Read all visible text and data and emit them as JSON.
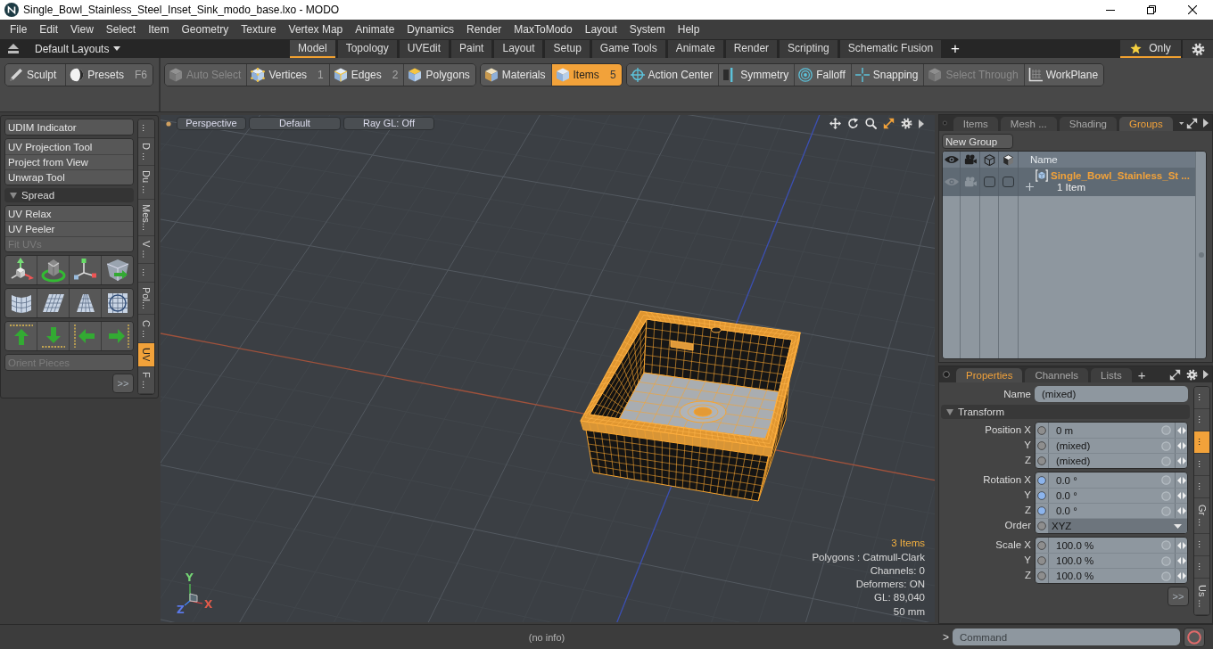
{
  "window": {
    "title": "Single_Bowl_Stainless_Steel_Inset_Sink_modo_base.lxo - MODO"
  },
  "menu": [
    "File",
    "Edit",
    "View",
    "Select",
    "Item",
    "Geometry",
    "Texture",
    "Vertex Map",
    "Animate",
    "Dynamics",
    "Render",
    "MaxToModo",
    "Layout",
    "System",
    "Help"
  ],
  "layout_bar": {
    "layouts": "Default Layouts",
    "tabs": [
      {
        "label": "Model",
        "selected": true
      },
      {
        "label": "Topology",
        "selected": false
      },
      {
        "label": "UVEdit",
        "selected": false
      },
      {
        "label": "Paint",
        "selected": false
      },
      {
        "label": "Layout",
        "selected": false
      },
      {
        "label": "Setup",
        "selected": false
      },
      {
        "label": "Game Tools",
        "selected": false
      },
      {
        "label": "Animate",
        "selected": false
      },
      {
        "label": "Render",
        "selected": false
      },
      {
        "label": "Scripting",
        "selected": false
      },
      {
        "label": "Schematic Fusion",
        "selected": false
      }
    ],
    "add": "+",
    "filter": {
      "label": "Only",
      "on": true
    }
  },
  "toolbar": {
    "groups": [
      {
        "items": [
          {
            "label": "Sculpt",
            "selected": false,
            "disabled": false
          },
          {
            "label": "Presets",
            "shortcut": "F6",
            "selected": false,
            "disabled": false
          }
        ]
      },
      {
        "items": [
          {
            "label": "Auto Select",
            "selected": false,
            "disabled": true
          },
          {
            "label": "Vertices",
            "shortcut": "1",
            "selected": false,
            "disabled": false
          },
          {
            "label": "Edges",
            "shortcut": "2",
            "selected": false,
            "disabled": false
          },
          {
            "label": "Polygons",
            "selected": false,
            "disabled": false
          }
        ]
      },
      {
        "items": [
          {
            "label": "Materials",
            "selected": false,
            "disabled": false
          },
          {
            "label": "Items",
            "shortcut": "5",
            "selected": true,
            "disabled": false
          }
        ]
      },
      {
        "items": [
          {
            "label": "Action Center",
            "selected": false,
            "disabled": false
          },
          {
            "label": "Symmetry",
            "selected": false,
            "disabled": false
          },
          {
            "label": "Falloff",
            "selected": false,
            "disabled": false
          },
          {
            "label": "Snapping",
            "selected": false,
            "disabled": false
          },
          {
            "label": "Select Through",
            "selected": false,
            "disabled": true
          },
          {
            "label": "WorkPlane",
            "selected": false,
            "disabled": false
          }
        ]
      }
    ]
  },
  "left_panel": {
    "sections": [
      {
        "kind": "buttons",
        "items": [
          {
            "label": "UDIM Indicator",
            "disabled": false
          }
        ]
      },
      {
        "kind": "buttons",
        "items": [
          {
            "label": "UV Projection Tool",
            "disabled": false
          },
          {
            "label": "Project from View",
            "disabled": false
          },
          {
            "label": "Unwrap Tool",
            "disabled": false
          }
        ]
      },
      {
        "kind": "header",
        "label": "Spread",
        "expanded": true
      },
      {
        "kind": "buttons",
        "items": [
          {
            "label": "UV Relax",
            "disabled": false
          },
          {
            "label": "UV Peeler",
            "disabled": false
          },
          {
            "label": "Fit UVs",
            "disabled": true
          }
        ]
      },
      {
        "kind": "icon_row"
      },
      {
        "kind": "icon_row"
      },
      {
        "kind": "icon_row"
      },
      {
        "kind": "buttons",
        "items": [
          {
            "label": "Orient Pieces",
            "disabled": true
          }
        ]
      }
    ],
    "more": ">>",
    "side_tabs": [
      {
        "label": "...",
        "selected": false
      },
      {
        "label": "D ...",
        "selected": false
      },
      {
        "label": "Du ...",
        "selected": false
      },
      {
        "label": "Mes...",
        "selected": false
      },
      {
        "label": "V ...",
        "selected": false
      },
      {
        "label": "...",
        "selected": false
      },
      {
        "label": "Pol...",
        "selected": false
      },
      {
        "label": "C ...",
        "selected": false
      },
      {
        "label": "UV",
        "selected": true
      },
      {
        "label": "F ...",
        "selected": false
      }
    ]
  },
  "viewport": {
    "view_buttons": [
      "Perspective",
      "Default",
      "Ray GL: Off"
    ],
    "axis_labels": [
      {
        "text": "Y",
        "color": "#74d474"
      },
      {
        "text": "X",
        "color": "#e05a4a"
      },
      {
        "text": "Z",
        "color": "#5a78e8"
      }
    ],
    "stats": [
      {
        "text": "3 Items",
        "highlighted": true
      },
      {
        "text": "Polygons : Catmull-Clark",
        "highlighted": false
      },
      {
        "text": "Channels: 0",
        "highlighted": false
      },
      {
        "text": "Deformers: ON",
        "highlighted": false
      },
      {
        "text": "GL: 89,040",
        "highlighted": false
      },
      {
        "text": "50 mm",
        "highlighted": false
      }
    ]
  },
  "status_bar": {
    "info": "(no info)"
  },
  "groups_panel": {
    "tabs": [
      {
        "label": "Items",
        "selected": false
      },
      {
        "label": "Mesh ...",
        "selected": false
      },
      {
        "label": "Shading",
        "selected": false
      },
      {
        "label": "Groups",
        "selected": true
      }
    ],
    "new_group": "New Group",
    "name_column": "Name",
    "rows": [
      {
        "name": "Single_Bowl_Stainless_St ...",
        "count": "1 Item",
        "selected": true,
        "expanded": false,
        "toggles": [
          {
            "on": false
          },
          {
            "on": false
          }
        ]
      }
    ]
  },
  "properties_panel": {
    "tabs": [
      {
        "label": "Properties",
        "selected": true
      },
      {
        "label": "Channels",
        "selected": false
      },
      {
        "label": "Lists",
        "selected": false
      }
    ],
    "add": "+",
    "name": {
      "label": "Name",
      "value": "(mixed)"
    },
    "section": {
      "label": "Transform",
      "expanded": true
    },
    "groups": [
      {
        "rows": [
          {
            "kind": "value",
            "label": "Position X",
            "value": "0 m",
            "color": "#8e8e8e"
          },
          {
            "kind": "value",
            "label": "Y",
            "value": "(mixed)",
            "color": "#8e8e8e"
          },
          {
            "kind": "value",
            "label": "Z",
            "value": "(mixed)",
            "color": "#8e8e8e"
          }
        ]
      },
      {
        "rows": [
          {
            "kind": "value",
            "label": "Rotation X",
            "value": "0.0 °",
            "color": "#8cb4ec"
          },
          {
            "kind": "value",
            "label": "Y",
            "value": "0.0 °",
            "color": "#8cb4ec"
          },
          {
            "kind": "value",
            "label": "Z",
            "value": "0.0 °",
            "color": "#8cb4ec"
          },
          {
            "kind": "dropdown",
            "label": "Order",
            "value": "XYZ",
            "color": "#8e8e8e"
          }
        ]
      },
      {
        "rows": [
          {
            "kind": "value",
            "label": "Scale X",
            "value": "100.0 %",
            "color": "#8e8e8e"
          },
          {
            "kind": "value",
            "label": "Y",
            "value": "100.0 %",
            "color": "#8e8e8e"
          },
          {
            "kind": "value",
            "label": "Z",
            "value": "100.0 %",
            "color": "#8e8e8e"
          }
        ]
      }
    ],
    "more": ">>",
    "side_tabs": [
      {
        "label": "...",
        "selected": false
      },
      {
        "label": "...",
        "selected": false
      },
      {
        "label": "...",
        "selected": true
      },
      {
        "label": "...",
        "selected": false
      },
      {
        "label": "...",
        "selected": false
      },
      {
        "label": "Gr ...",
        "selected": false
      },
      {
        "label": "...",
        "selected": false
      },
      {
        "label": "...",
        "selected": false
      },
      {
        "label": "Us ...",
        "selected": false
      }
    ]
  },
  "command_bar": {
    "prompt": ">",
    "placeholder": "Command"
  }
}
